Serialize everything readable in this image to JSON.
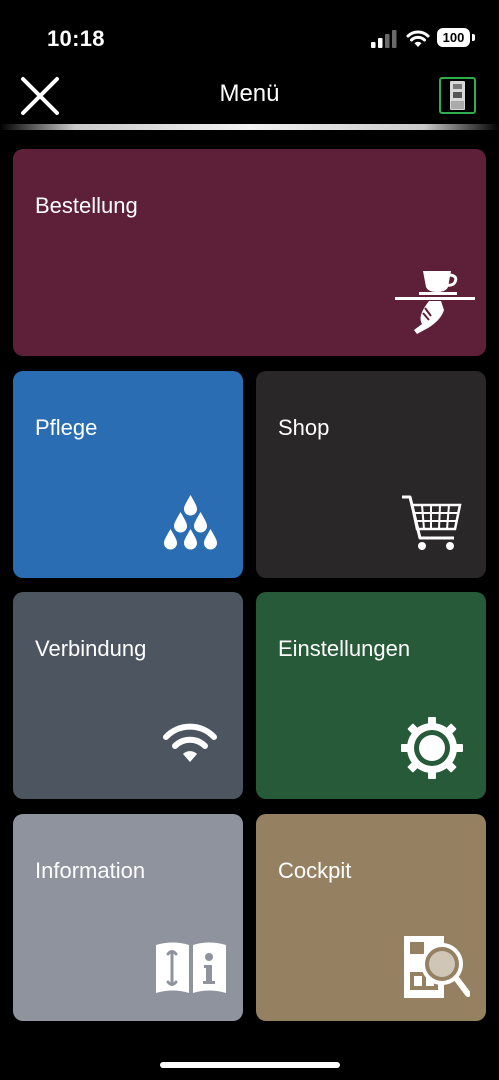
{
  "status_bar": {
    "time": "10:18",
    "battery": "100"
  },
  "header": {
    "title": "Menü"
  },
  "tiles": [
    {
      "label": "Bestellung",
      "icon": "serving-tray-cup-icon",
      "color": "#5d2038"
    },
    {
      "label": "Pflege",
      "icon": "water-drops-icon",
      "color": "#2a6db3"
    },
    {
      "label": "Shop",
      "icon": "shopping-cart-icon",
      "color": "#292728"
    },
    {
      "label": "Verbindung",
      "icon": "wifi-icon",
      "color": "#4d5560"
    },
    {
      "label": "Einstellungen",
      "icon": "gear-icon",
      "color": "#275a38"
    },
    {
      "label": "Information",
      "icon": "manual-book-icon",
      "color": "#8e939d"
    },
    {
      "label": "Cockpit",
      "icon": "machine-magnifier-icon",
      "color": "#958061"
    }
  ],
  "colors": {
    "machine_button_border": "#2fae4e",
    "background": "#000000"
  }
}
